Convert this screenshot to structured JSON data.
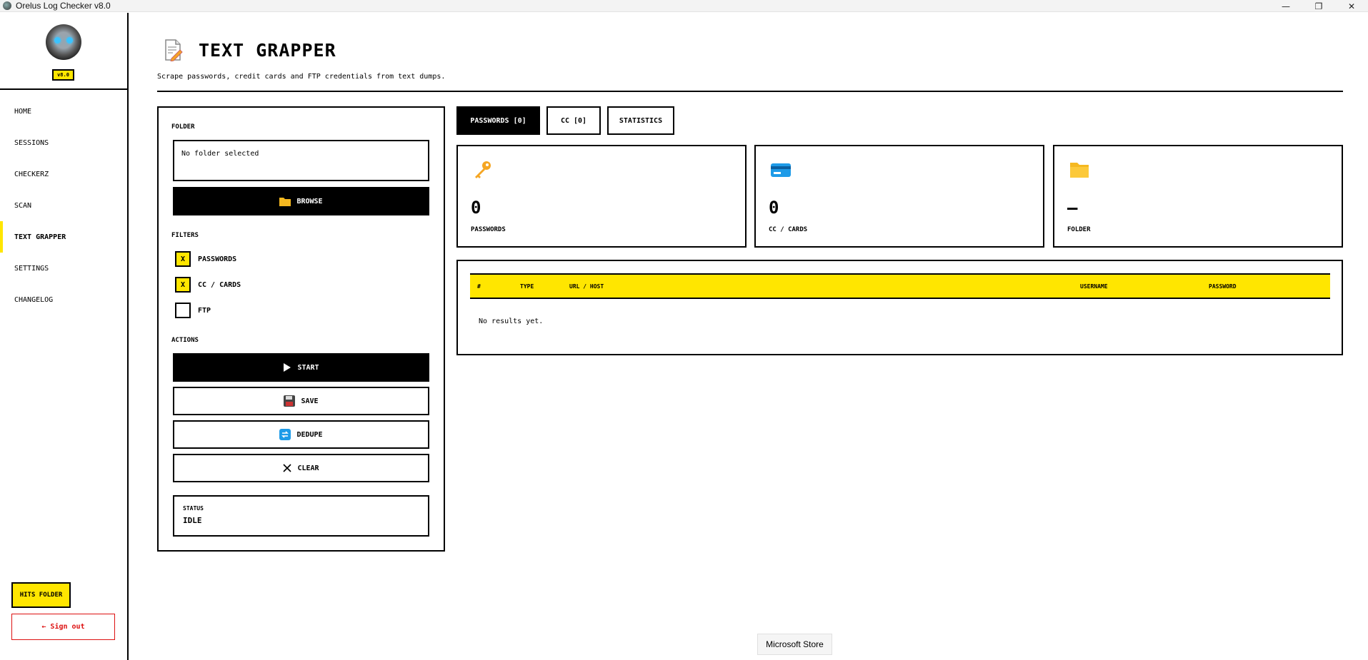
{
  "window": {
    "title": "Orelus Log Checker v8.0",
    "minimize": "—",
    "maximize": "❐",
    "close": "✕"
  },
  "sidebar": {
    "version": "v8.0",
    "items": [
      {
        "label": "HOME"
      },
      {
        "label": "SESSIONS"
      },
      {
        "label": "CHECKERZ"
      },
      {
        "label": "SCAN"
      },
      {
        "label": "TEXT GRAPPER",
        "active": true
      },
      {
        "label": "SETTINGS"
      },
      {
        "label": "CHANGELOG"
      }
    ],
    "hits_folder": "HITS FOLDER",
    "sign_out": "← Sign out"
  },
  "header": {
    "title": "TEXT GRAPPER",
    "subtitle": "Scrape passwords, credit cards and FTP credentials from text dumps.",
    "icon": "memo-icon"
  },
  "left_panel": {
    "folder_label": "FOLDER",
    "folder_value": "No folder selected",
    "browse": "BROWSE",
    "filters_label": "FILTERS",
    "filters": [
      {
        "label": "PASSWORDS",
        "checked": true,
        "mark": "X"
      },
      {
        "label": "CC / CARDS",
        "checked": true,
        "mark": "X"
      },
      {
        "label": "FTP",
        "checked": false,
        "mark": ""
      }
    ],
    "actions_label": "ACTIONS",
    "actions": {
      "start": "START",
      "save": "SAVE",
      "dedupe": "DEDUPE",
      "clear": "CLEAR"
    },
    "status_label": "STATUS",
    "status_value": "IDLE"
  },
  "tabs": [
    {
      "label": "PASSWORDS  [0]",
      "active": true
    },
    {
      "label": "CC  [0]",
      "active": false
    },
    {
      "label": "STATISTICS",
      "active": false
    }
  ],
  "cards": [
    {
      "icon": "key-icon",
      "value": "0",
      "label": "PASSWORDS"
    },
    {
      "icon": "credit-card-icon",
      "value": "0",
      "label": "CC / CARDS"
    },
    {
      "icon": "folder-icon",
      "value": "–",
      "label": "FOLDER"
    }
  ],
  "table": {
    "columns": [
      "#",
      "TYPE",
      "URL / HOST",
      "USERNAME",
      "PASSWORD"
    ],
    "empty_text": "No results yet."
  },
  "tooltip": "Microsoft Store",
  "colors": {
    "accent": "#ffe600",
    "danger": "#dd1111",
    "dark": "#000000"
  }
}
